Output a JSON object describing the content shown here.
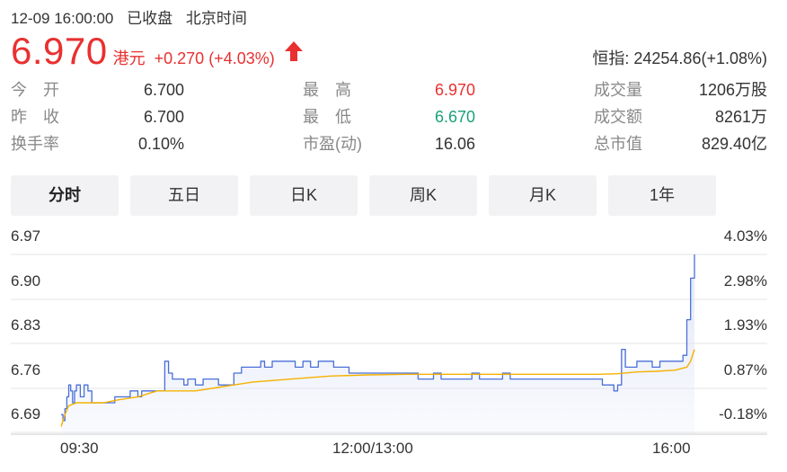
{
  "status": {
    "datetime": "12-09 16:00:00",
    "state": "已收盘",
    "timezone": "北京时间"
  },
  "quote": {
    "price": "6.970",
    "currency": "港元",
    "change": "+0.270",
    "change_pct": "(+4.03%)",
    "direction": "up",
    "up_color": "#e93030",
    "down_color": "#1aa17a"
  },
  "index": {
    "label": "恒指:",
    "value": "24254.86(+1.08%)"
  },
  "stats": {
    "open": {
      "label": "今　开",
      "value": "6.700"
    },
    "prev_close": {
      "label": "昨　收",
      "value": "6.700"
    },
    "turnover_rate": {
      "label": "换手率",
      "value": "0.10%"
    },
    "high": {
      "label": "最　高",
      "value": "6.970"
    },
    "low": {
      "label": "最　低",
      "value": "6.670"
    },
    "pe": {
      "label": "市盈(动)",
      "value": "16.06"
    },
    "volume": {
      "label": "成交量",
      "value": "1206万股"
    },
    "amount": {
      "label": "成交额",
      "value": "8261万"
    },
    "market_cap": {
      "label": "总市值",
      "value": "829.40亿"
    }
  },
  "tabs": [
    {
      "label": "分时",
      "active": true
    },
    {
      "label": "五日",
      "active": false
    },
    {
      "label": "日K",
      "active": false
    },
    {
      "label": "周K",
      "active": false
    },
    {
      "label": "月K",
      "active": false
    },
    {
      "label": "1年",
      "active": false
    }
  ],
  "chart_data": {
    "type": "line",
    "title": "",
    "xlabel": "",
    "ylabel": "",
    "ylim": [
      6.67,
      6.97
    ],
    "y_ticks": [
      "6.97",
      "6.90",
      "6.83",
      "6.76",
      "6.69"
    ],
    "y2_ticks": [
      "4.03%",
      "2.98%",
      "1.93%",
      "0.87%",
      "-0.18%"
    ],
    "x_ticks": [
      "09:30",
      "12:00/13:00",
      "16:00"
    ],
    "x_range": [
      0,
      330
    ],
    "grid": true,
    "colors": {
      "price": "#4a6fd8",
      "average": "#f5b100",
      "fill": "#dde4f7"
    },
    "series": [
      {
        "role": "price",
        "x": [
          0,
          1,
          2,
          3,
          4,
          5,
          6,
          7,
          8,
          10,
          12,
          14,
          16,
          18,
          22,
          24,
          28,
          32,
          36,
          40,
          42,
          46,
          50,
          54,
          56,
          58,
          60,
          62,
          64,
          66,
          70,
          74,
          78,
          82,
          86,
          90,
          94,
          98,
          102,
          104,
          106,
          110,
          114,
          118,
          122,
          126,
          130,
          134,
          138,
          142,
          146,
          150,
          154,
          158,
          162,
          166,
          170,
          174,
          178,
          182,
          186,
          190,
          194,
          198,
          202,
          206,
          210,
          214,
          218,
          222,
          226,
          230,
          234,
          238,
          242,
          246,
          250,
          254,
          258,
          262,
          266,
          270,
          274,
          278,
          282,
          286,
          288,
          290,
          292,
          294,
          296,
          300,
          304,
          308,
          312,
          316,
          320,
          324,
          326,
          328,
          330
        ],
        "y": [
          6.7,
          6.69,
          6.71,
          6.73,
          6.75,
          6.74,
          6.72,
          6.74,
          6.75,
          6.73,
          6.75,
          6.74,
          6.72,
          6.72,
          6.72,
          6.72,
          6.73,
          6.73,
          6.74,
          6.73,
          6.74,
          6.74,
          6.74,
          6.79,
          6.77,
          6.76,
          6.76,
          6.76,
          6.75,
          6.76,
          6.75,
          6.76,
          6.76,
          6.75,
          6.75,
          6.77,
          6.78,
          6.78,
          6.78,
          6.79,
          6.78,
          6.79,
          6.79,
          6.79,
          6.78,
          6.79,
          6.78,
          6.79,
          6.79,
          6.78,
          6.78,
          6.77,
          6.77,
          6.77,
          6.77,
          6.77,
          6.77,
          6.77,
          6.77,
          6.77,
          6.76,
          6.76,
          6.77,
          6.76,
          6.76,
          6.76,
          6.76,
          6.77,
          6.76,
          6.76,
          6.76,
          6.77,
          6.76,
          6.76,
          6.76,
          6.76,
          6.76,
          6.76,
          6.76,
          6.76,
          6.76,
          6.76,
          6.76,
          6.76,
          6.75,
          6.75,
          6.74,
          6.75,
          6.81,
          6.78,
          6.78,
          6.79,
          6.79,
          6.78,
          6.79,
          6.79,
          6.79,
          6.8,
          6.86,
          6.93,
          6.97
        ]
      },
      {
        "role": "average",
        "x": [
          0,
          2,
          4,
          8,
          14,
          22,
          30,
          40,
          50,
          60,
          70,
          80,
          90,
          100,
          120,
          140,
          160,
          180,
          200,
          220,
          240,
          260,
          280,
          290,
          300,
          310,
          320,
          326,
          328,
          330
        ],
        "y": [
          6.68,
          6.7,
          6.715,
          6.72,
          6.72,
          6.72,
          6.725,
          6.73,
          6.74,
          6.74,
          6.74,
          6.745,
          6.75,
          6.755,
          6.76,
          6.765,
          6.767,
          6.768,
          6.768,
          6.768,
          6.768,
          6.768,
          6.768,
          6.769,
          6.772,
          6.773,
          6.775,
          6.78,
          6.79,
          6.81
        ]
      }
    ]
  }
}
